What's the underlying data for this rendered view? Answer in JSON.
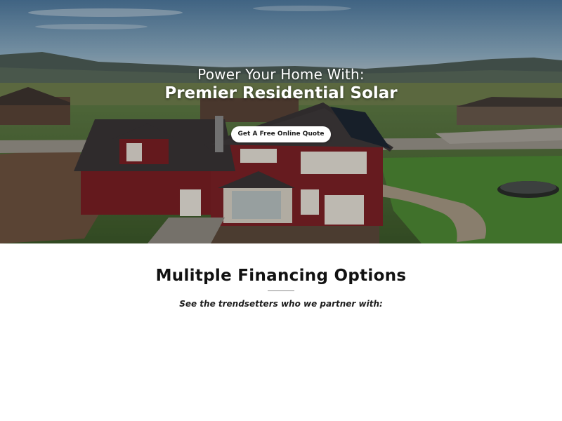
{
  "hero": {
    "line1": "Power Your Home With:",
    "line2": "Premier Residential Solar",
    "cta_label": "Get A Free Online Quote"
  },
  "section": {
    "title": "Mulitple Financing Options",
    "subtitle": "See the trendsetters who we partner with:"
  },
  "colors": {
    "sky": "#5f87a6",
    "lawn": "#4e8a3a",
    "house_wall": "#7a1f24",
    "roof": "#3a3536",
    "button_bg": "#ffffff",
    "title_text": "#111111"
  }
}
